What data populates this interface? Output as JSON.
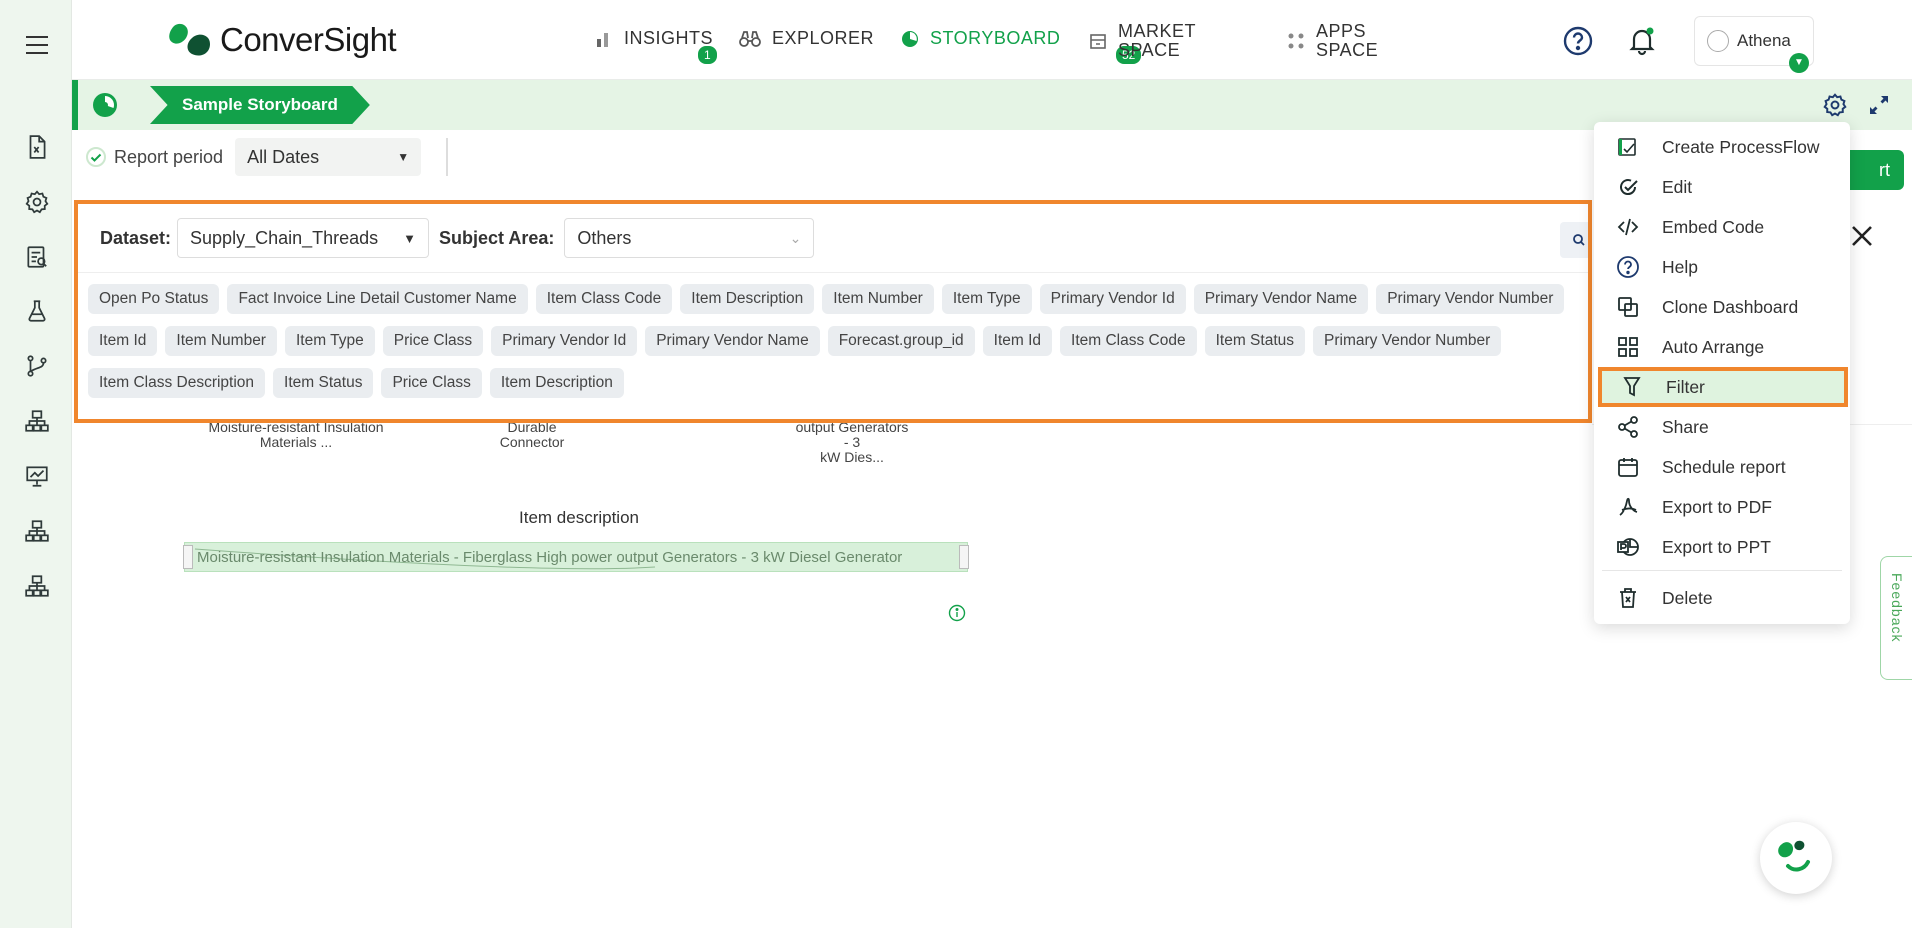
{
  "app": {
    "logo_text": "ConverSight",
    "brand_color": "#12a14a",
    "highlight_color": "#f0862d"
  },
  "nav": {
    "insights": {
      "label": "INSIGHTS",
      "badge": "1"
    },
    "explorer": {
      "label": "EXPLORER"
    },
    "storyboard": {
      "label": "STORYBOARD",
      "badge": "52"
    },
    "market": {
      "line1": "MARKET",
      "line2": "SPACE"
    },
    "apps": {
      "line1": "APPS",
      "line2": "SPACE"
    },
    "user_name": "Athena"
  },
  "storyboard_bar": {
    "tab_label": "Sample Storyboard"
  },
  "report_period": {
    "label": "Report period",
    "value": "All Dates"
  },
  "filter_panel": {
    "dataset_label": "Dataset:",
    "dataset_value": "Supply_Chain_Threads",
    "subject_label": "Subject Area:",
    "subject_value": "Others",
    "chips_row1": [
      "Open Po Status",
      "Fact Invoice Line Detail Customer Name",
      "Item Class Code",
      "Item Description",
      "Item Number",
      "Item Type",
      "Primary Vendor Id",
      "Primary Vendor Name",
      "Primary Vendor Number"
    ],
    "chips_row2": [
      "Item Id",
      "Item Number",
      "Item Type",
      "Price Class",
      "Primary Vendor Id",
      "Primary Vendor Name",
      "Forecast.group_id",
      "Item Id",
      "Item Class Code",
      "Item Status",
      "Primary Vendor Number"
    ],
    "chips_row3": [
      "Item Class Description",
      "Item Status",
      "Price Class",
      "Item Description"
    ]
  },
  "chart_card": {
    "bar_label_1_l1": "Moisture-resistant Insulation",
    "bar_label_1_l2": "Materials ...",
    "bar_label_2_l1": "Durable",
    "bar_label_2_l2": "Connector",
    "bar_label_3_l1": "output Generators",
    "bar_label_3_l2": "- 3",
    "bar_label_3_l3": "kW Dies...",
    "axis_title": "Item description",
    "range_text": "Moisture-resistant Insulation Materials - Fiberglass High power output Generators - 3 kW Diesel Generator"
  },
  "menu": {
    "items": [
      {
        "label": "Create ProcessFlow",
        "icon": "processflow-icon"
      },
      {
        "label": "Edit",
        "icon": "edit-icon"
      },
      {
        "label": "Embed Code",
        "icon": "code-icon"
      },
      {
        "label": "Help",
        "icon": "help-icon"
      },
      {
        "label": "Clone Dashboard",
        "icon": "clone-icon"
      },
      {
        "label": "Auto Arrange",
        "icon": "grid-icon"
      },
      {
        "label": "Filter",
        "icon": "filter-icon"
      },
      {
        "label": "Share",
        "icon": "share-icon"
      },
      {
        "label": "Schedule report",
        "icon": "calendar-icon"
      },
      {
        "label": "Export to PDF",
        "icon": "pdf-icon"
      },
      {
        "label": "Export to PPT",
        "icon": "ppt-icon"
      },
      {
        "label": "Delete",
        "icon": "trash-icon"
      }
    ]
  },
  "feedback_label": "Feedback"
}
